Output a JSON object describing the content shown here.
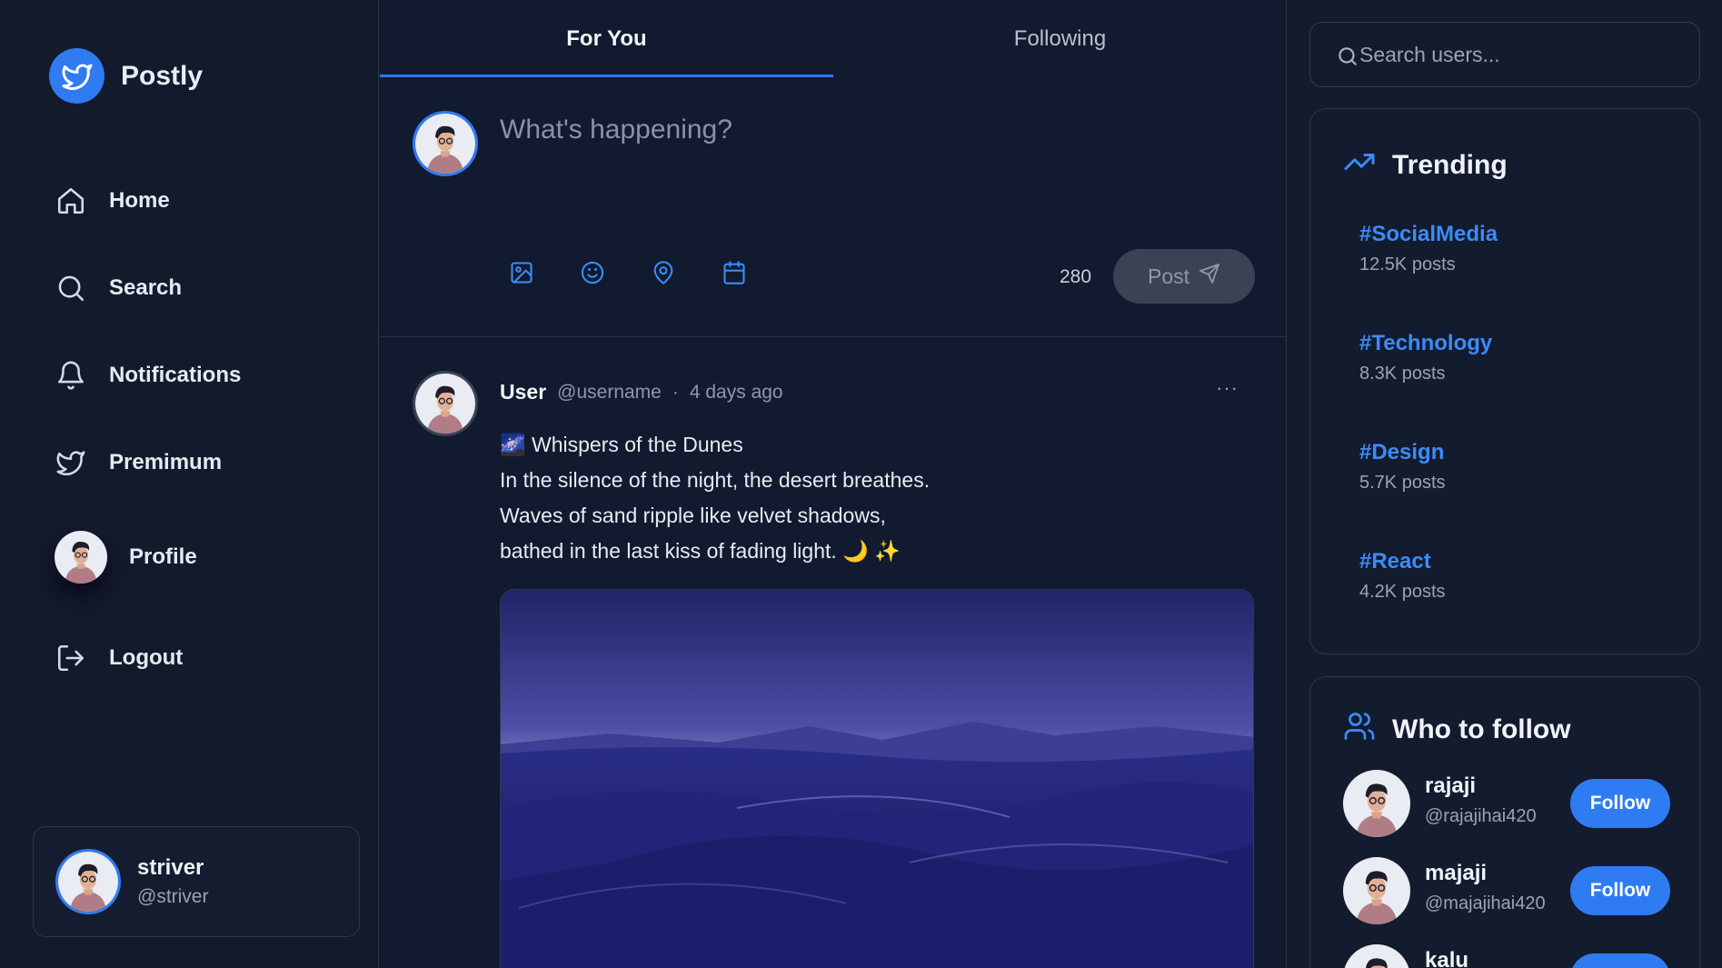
{
  "brand": {
    "name": "Postly",
    "logo_icon": "bird-icon",
    "accent": "#2f7bf1"
  },
  "nav": {
    "items": [
      {
        "label": "Home",
        "icon": "home-icon"
      },
      {
        "label": "Search",
        "icon": "search-icon"
      },
      {
        "label": "Notifications",
        "icon": "bell-icon"
      },
      {
        "label": "Premimum",
        "icon": "bird-icon"
      },
      {
        "label": "Profile",
        "icon": "avatar"
      },
      {
        "label": "Logout",
        "icon": "logout-icon"
      }
    ]
  },
  "account": {
    "name": "striver",
    "handle": "@striver"
  },
  "feed": {
    "tabs": [
      {
        "label": "For You",
        "active": true
      },
      {
        "label": "Following",
        "active": false
      }
    ]
  },
  "composer": {
    "placeholder": "What's happening?",
    "tools": [
      "image-icon",
      "emoji-icon",
      "location-icon",
      "calendar-icon"
    ],
    "char_count": "280",
    "post_label": "Post"
  },
  "post": {
    "user": "User",
    "handle": "@username",
    "separator": "·",
    "time": "4 days ago",
    "more": "···",
    "lines": [
      "🌌 Whispers of the Dunes",
      "In the silence of the night, the desert breathes.",
      "Waves of sand ripple like velvet shadows,",
      "bathed in the last kiss of fading light. 🌙 ✨"
    ]
  },
  "search": {
    "placeholder": "Search users..."
  },
  "trending": {
    "title": "Trending",
    "items": [
      {
        "tag": "#SocialMedia",
        "count": "12.5K posts"
      },
      {
        "tag": "#Technology",
        "count": "8.3K posts"
      },
      {
        "tag": "#Design",
        "count": "5.7K posts"
      },
      {
        "tag": "#React",
        "count": "4.2K posts"
      }
    ]
  },
  "who_to_follow": {
    "title": "Who to follow",
    "users": [
      {
        "name": "rajaji",
        "handle": "@rajajihai420",
        "button": "Follow"
      },
      {
        "name": "majaji",
        "handle": "@majajihai420",
        "button": "Follow"
      },
      {
        "name": "kalu",
        "handle": "",
        "button": "Follow"
      }
    ]
  }
}
